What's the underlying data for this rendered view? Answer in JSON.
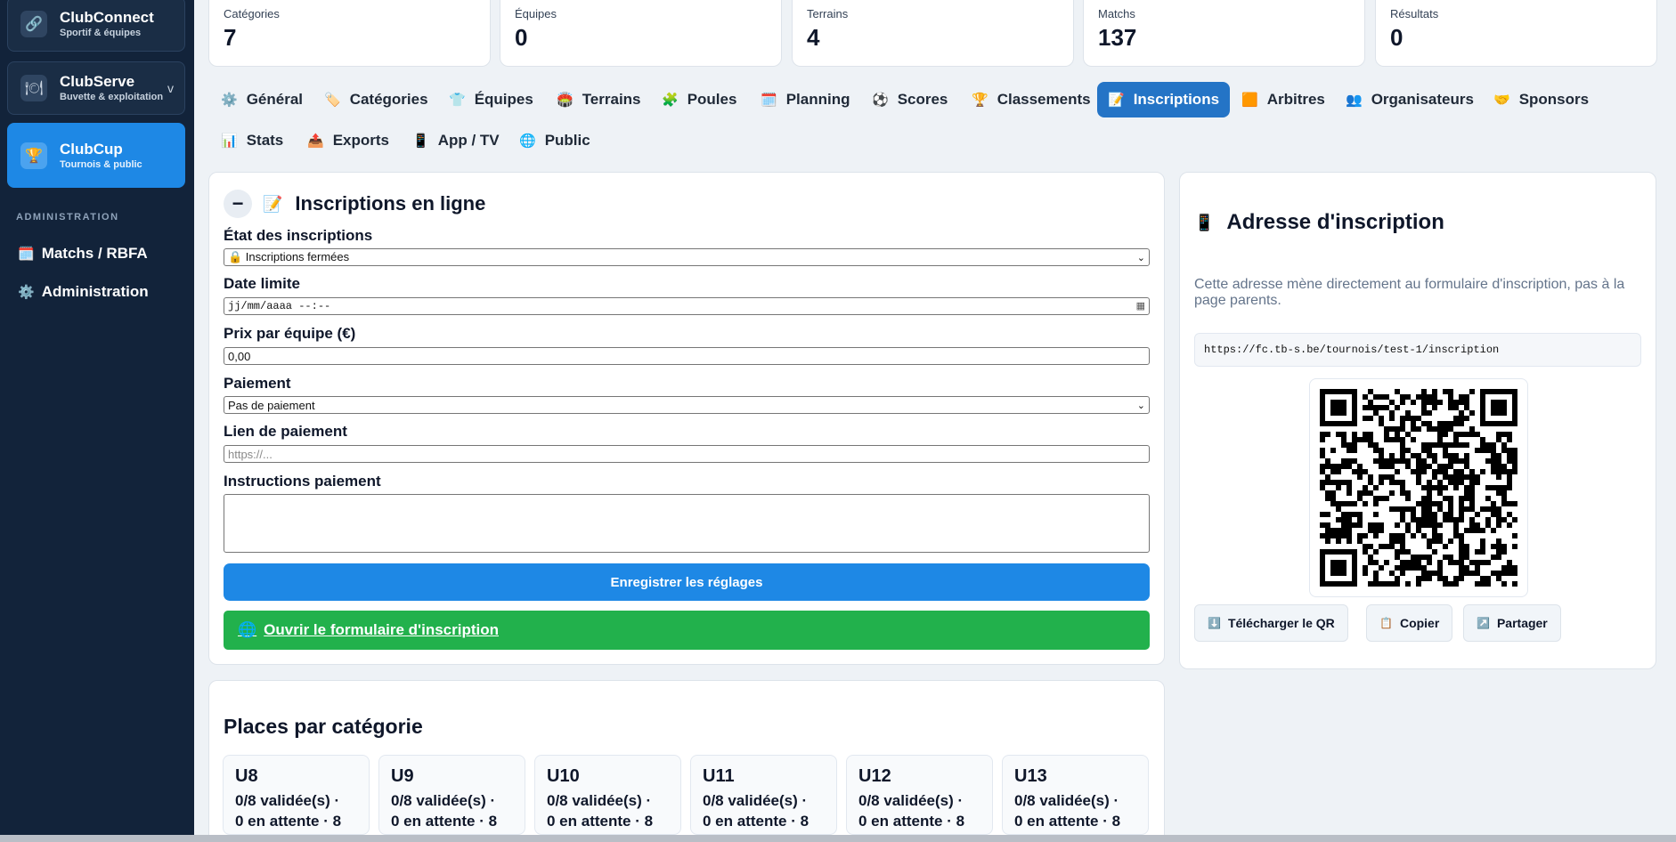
{
  "sidebar": {
    "apps": [
      {
        "name": "ClubConnect",
        "sub": "Sportif & équipes",
        "icon": "link-icon"
      },
      {
        "name": "ClubServe",
        "sub": "Buvette & exploitation",
        "icon": "plate-icon",
        "chevron": "v"
      },
      {
        "name": "ClubCup",
        "sub": "Tournois & public",
        "icon": "trophy-icon"
      }
    ],
    "section": "ADMINISTRATION",
    "links": [
      {
        "label": "Matchs / RBFA",
        "icon": "calendar-icon"
      },
      {
        "label": "Administration",
        "icon": "gear-icon"
      }
    ]
  },
  "stats": [
    {
      "label": "Catégories",
      "value": "7"
    },
    {
      "label": "Équipes",
      "value": "0"
    },
    {
      "label": "Terrains",
      "value": "4"
    },
    {
      "label": "Matchs",
      "value": "137"
    },
    {
      "label": "Résultats",
      "value": "0"
    }
  ],
  "tabs": [
    {
      "label": "Général",
      "icon": "⚙️"
    },
    {
      "label": "Catégories",
      "icon": "🏷️"
    },
    {
      "label": "Équipes",
      "icon": "👕"
    },
    {
      "label": "Terrains",
      "icon": "🏟️"
    },
    {
      "label": "Poules",
      "icon": "🧩"
    },
    {
      "label": "Planning",
      "icon": "🗓️"
    },
    {
      "label": "Scores",
      "icon": "⚽"
    },
    {
      "label": "Classements",
      "icon": "🏆"
    },
    {
      "label": "Inscriptions",
      "icon": "📝",
      "active": true
    },
    {
      "label": "Arbitres",
      "icon": "🟧"
    },
    {
      "label": "Organisateurs",
      "icon": "👥"
    },
    {
      "label": "Sponsors",
      "icon": "🤝"
    },
    {
      "label": "Stats",
      "icon": "📊"
    },
    {
      "label": "Exports",
      "icon": "📤"
    },
    {
      "label": "App / TV",
      "icon": "📱"
    },
    {
      "label": "Public",
      "icon": "🌐"
    }
  ],
  "registration": {
    "collapse": "−",
    "title": "Inscriptions en ligne",
    "title_icon": "📝",
    "state_label": "État des inscriptions",
    "state_value": "🔒 Inscriptions fermées",
    "deadline_label": "Date limite",
    "deadline_value": "jj/mm/aaaa --:--",
    "price_label": "Prix par équipe (€)",
    "price_value": "0,00",
    "payment_label": "Paiement",
    "payment_value": "Pas de paiement",
    "paylink_label": "Lien de paiement",
    "paylink_placeholder": "https://...",
    "instructions_label": "Instructions paiement",
    "save_button": "Enregistrer les réglages",
    "open_form_button": "Ouvrir le formulaire d'inscription",
    "open_form_icon": "🌐"
  },
  "address": {
    "title": "Adresse d'inscription",
    "title_icon": "📱",
    "description": "Cette adresse mène directement au formulaire d'inscription, pas à la page parents.",
    "url": "https://fc.tb-s.be/tournois/test-1/inscription",
    "buttons": [
      {
        "label": "Télécharger le QR",
        "icon": "⬇️"
      },
      {
        "label": "Copier",
        "icon": "📋"
      },
      {
        "label": "Partager",
        "icon": "↗️"
      }
    ]
  },
  "places": {
    "title": "Places par catégorie",
    "categories": [
      {
        "name": "U8",
        "line1": "0/8 validée(s) ·",
        "line2": "0 en attente · 8"
      },
      {
        "name": "U9",
        "line1": "0/8 validée(s) ·",
        "line2": "0 en attente · 8"
      },
      {
        "name": "U10",
        "line1": "0/8 validée(s) ·",
        "line2": "0 en attente · 8"
      },
      {
        "name": "U11",
        "line1": "0/8 validée(s) ·",
        "line2": "0 en attente · 8"
      },
      {
        "name": "U12",
        "line1": "0/8 validée(s) ·",
        "line2": "0 en attente · 8"
      },
      {
        "name": "U13",
        "line1": "0/8 validée(s) ·",
        "line2": "0 en attente · 8"
      }
    ]
  },
  "colors": {
    "accent": "#1e88e5",
    "sidebar": "#12233a",
    "success": "#22b14c",
    "active_tab": "#2474c6"
  }
}
